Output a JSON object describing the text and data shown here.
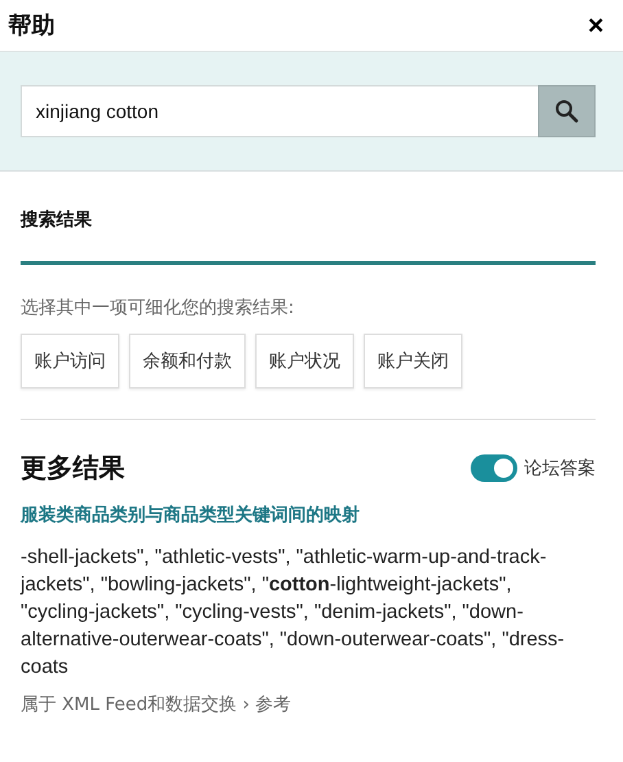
{
  "panel": {
    "title": "帮助",
    "close": "×"
  },
  "search": {
    "value": "xinjiang cotton"
  },
  "results_section": {
    "heading": "搜索结果",
    "hint": "选择其中一项可细化您的搜索结果:",
    "filters": [
      {
        "label": "账户访问"
      },
      {
        "label": "余额和付款"
      },
      {
        "label": "账户状况"
      },
      {
        "label": "账户关闭"
      }
    ]
  },
  "more_results": {
    "heading": "更多结果",
    "toggle": {
      "label": "论坛答案",
      "on": true
    },
    "results": [
      {
        "title": "服装类商品类别与商品类型关键词间的映射",
        "snippet": "-shell-jackets\", \"athletic-vests\", \"athletic-warm-up-and-track-jackets\", \"bowling-jackets\", \"**cotton**-lightweight-jackets\", \"cycling-jackets\", \"cycling-vests\", \"denim-jackets\", \"down-alternative-outerwear-coats\", \"down-outerwear-coats\", \"dress-coats",
        "breadcrumb": "属于 XML Feed和数据交换 › 参考"
      }
    ]
  }
}
